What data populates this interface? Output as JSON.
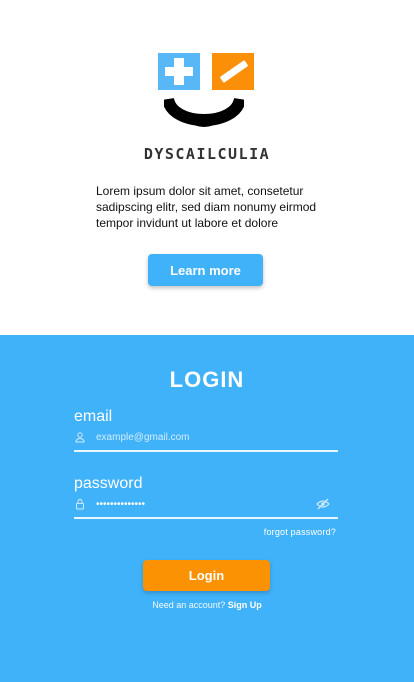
{
  "app": {
    "name": "DYSCAILCULIA",
    "description": "Lorem ipsum dolor sit amet, consetetur sadipscing elitr, sed diam nonumy eirmod tempor invidunt ut labore et dolore",
    "learn_more_label": "Learn more"
  },
  "login": {
    "title": "LOGIN",
    "email": {
      "label": "email",
      "placeholder": "example@gmail.com",
      "value": ""
    },
    "password": {
      "label": "password",
      "value": "••••••••••••••"
    },
    "forgot_label": "forgot password?",
    "submit_label": "Login",
    "signup_prompt": "Need an account?",
    "signup_link": "Sign Up"
  },
  "colors": {
    "primary_blue": "#40b2f9",
    "accent_orange": "#fb9203",
    "logo_blue": "#58b7f6",
    "logo_orange": "#fb8f08"
  },
  "icons": {
    "logo_left": "plus-icon",
    "logo_right": "minus-icon",
    "email_field": "user-icon",
    "password_field": "lock-icon",
    "password_toggle": "eye-off-icon"
  }
}
